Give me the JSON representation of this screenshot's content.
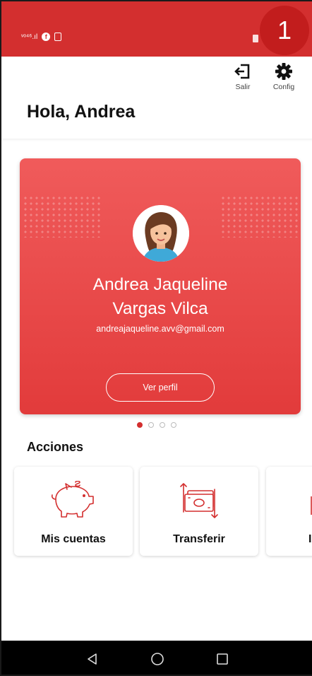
{
  "step_badge": "1",
  "header": {
    "logout_label": "Salir",
    "config_label": "Config",
    "greeting": "Hola, Andrea"
  },
  "profile": {
    "name_line1": "Andrea Jaqueline",
    "name_line2": "Vargas Vilca",
    "email": "andreajaqueline.avv@gmail.com",
    "view_profile_label": "Ver perfil"
  },
  "pager": {
    "pages": 4,
    "active": 1
  },
  "actions": {
    "title": "Acciones",
    "items": [
      {
        "label": "Mis cuentas",
        "icon": "piggy-bank-icon"
      },
      {
        "label": "Transferir",
        "icon": "money-transfer-icon"
      },
      {
        "label": "I",
        "icon": "partial-icon"
      }
    ]
  },
  "colors": {
    "brand_red": "#d32f2f",
    "card_red": "#e84545",
    "badge_red": "#c21d1d"
  }
}
